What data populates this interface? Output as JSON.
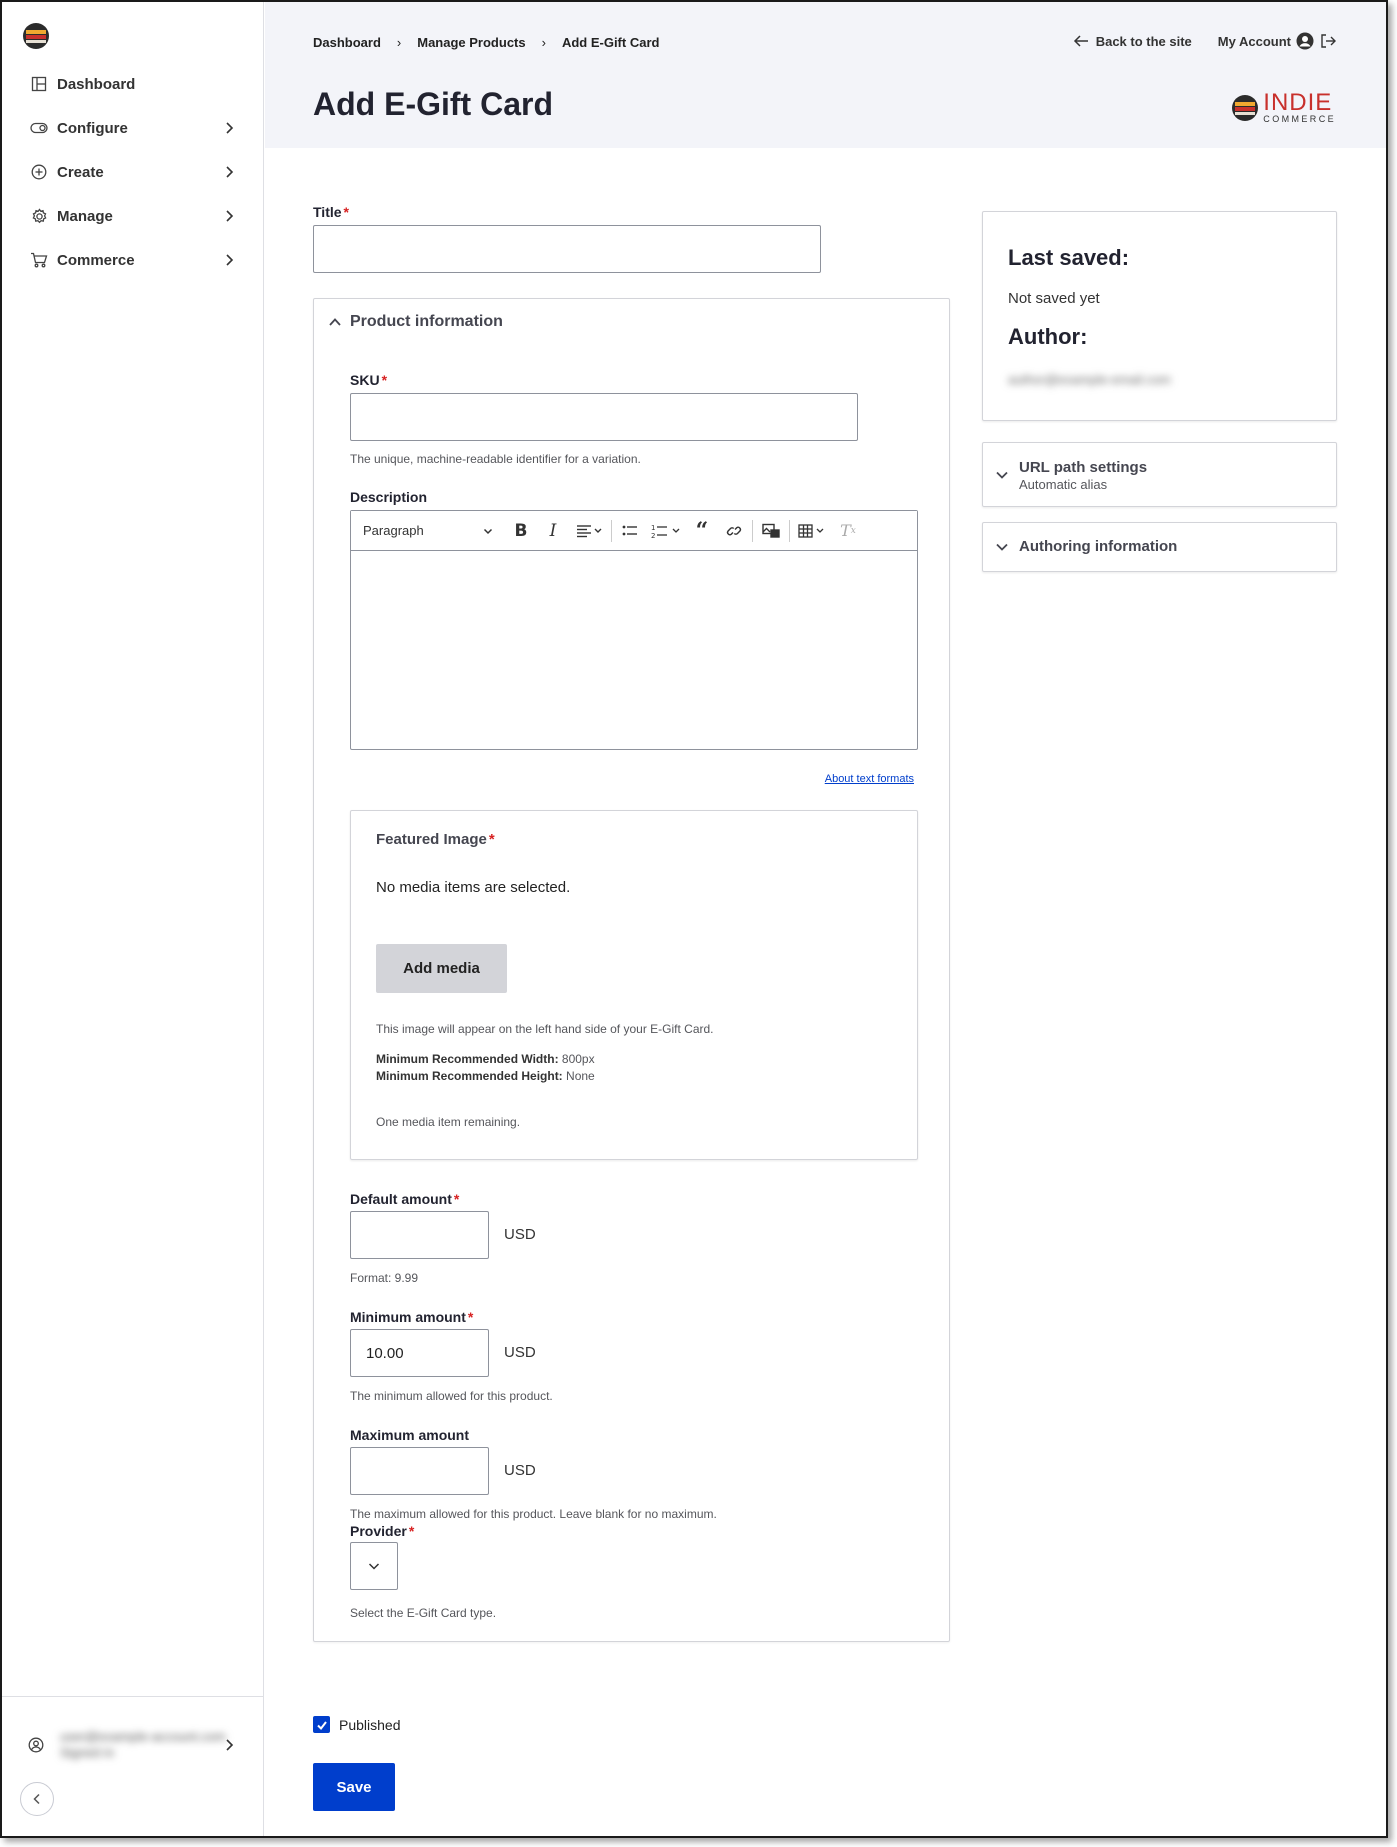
{
  "sidebar": {
    "items": [
      {
        "label": "Dashboard",
        "icon": "dashboard-icon"
      },
      {
        "label": "Configure",
        "icon": "toggle-icon"
      },
      {
        "label": "Create",
        "icon": "plus-circle-icon"
      },
      {
        "label": "Manage",
        "icon": "gear-icon"
      },
      {
        "label": "Commerce",
        "icon": "cart-icon"
      }
    ],
    "user_line1": "user@example-account.com",
    "user_line2": "Signed in"
  },
  "header": {
    "breadcrumb": [
      "Dashboard",
      "Manage Products",
      "Add E-Gift Card"
    ],
    "back_link": "Back to the site",
    "account_link": "My Account",
    "title": "Add E-Gift Card",
    "brand_main": "INDIE",
    "brand_sub": "COMMERCE"
  },
  "form": {
    "title_label": "Title",
    "product_info_label": "Product information",
    "sku_label": "SKU",
    "sku_desc": "The unique, machine-readable identifier for a variation.",
    "description_label": "Description",
    "toolbar_paragraph": "Paragraph",
    "about_text_formats": "About text formats",
    "featured_image_label": "Featured Image",
    "no_media": "No media items are selected.",
    "add_media": "Add media",
    "media_help": "This image will appear on the left hand side of your E-Gift Card.",
    "min_width_label": "Minimum Recommended Width:",
    "min_width_value": "800px",
    "min_height_label": "Minimum Recommended Height:",
    "min_height_value": "None",
    "media_remaining": "One media item remaining.",
    "default_amount_label": "Default amount",
    "default_amount_value": "",
    "default_amount_desc": "Format: 9.99",
    "minimum_amount_label": "Minimum amount",
    "minimum_amount_value": "10.00",
    "minimum_amount_desc": "The minimum allowed for this product.",
    "maximum_amount_label": "Maximum amount",
    "maximum_amount_value": "",
    "maximum_amount_desc": "The maximum allowed for this product. Leave blank for no maximum.",
    "currency": "USD",
    "provider_label": "Provider",
    "provider_desc": "Select the E-Gift Card type.",
    "published_label": "Published",
    "save_label": "Save"
  },
  "meta": {
    "last_saved_label": "Last saved:",
    "last_saved_value": "Not saved yet",
    "author_label": "Author:",
    "author_value": "author@example-email.com",
    "url_path_title": "URL path settings",
    "url_path_sub": "Automatic alias",
    "authoring_title": "Authoring information"
  },
  "colors": {
    "accent": "#003ecc",
    "header_bg": "#f3f4f9",
    "required": "#d72222",
    "brand_red": "#c8302c"
  }
}
